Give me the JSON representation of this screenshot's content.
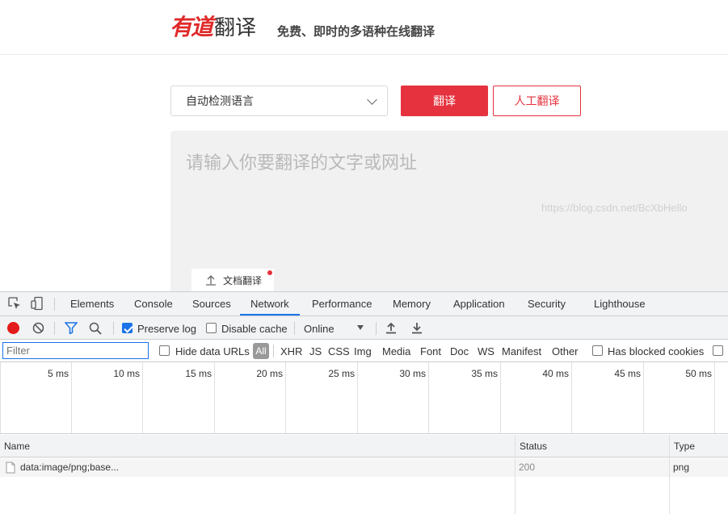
{
  "youdao": {
    "brand": "有道",
    "product": "翻译",
    "slogan": "免费、即时的多语种在线翻译",
    "lang_select": "自动检测语言",
    "translate_button": "翻译",
    "human_translate_button": "人工翻译",
    "input_placeholder": "请输入你要翻译的文字或网址",
    "doc_translate": "文档翻译",
    "accent_color": "#e5323e"
  },
  "devtools": {
    "tabs": [
      "Elements",
      "Console",
      "Sources",
      "Network",
      "Performance",
      "Memory",
      "Application",
      "Security",
      "Lighthouse"
    ],
    "active_tab": "Network",
    "toolbar": {
      "preserve_log": "Preserve log",
      "preserve_log_checked": true,
      "disable_cache": "Disable cache",
      "disable_cache_checked": false,
      "throttle": "Online"
    },
    "filter": {
      "placeholder": "Filter",
      "hide_data_urls": "Hide data URLs",
      "types": [
        "All",
        "XHR",
        "JS",
        "CSS",
        "Img",
        "Media",
        "Font",
        "Doc",
        "WS",
        "Manifest",
        "Other"
      ],
      "selected_type": "All",
      "has_blocked_cookies": "Has blocked cookies"
    },
    "timeline_ticks": [
      "5 ms",
      "10 ms",
      "15 ms",
      "20 ms",
      "25 ms",
      "30 ms",
      "35 ms",
      "40 ms",
      "45 ms",
      "50 ms"
    ],
    "table": {
      "columns": [
        "Name",
        "Status",
        "Type"
      ],
      "rows": [
        {
          "name": "data:image/png;base...",
          "status": "200",
          "type": "png"
        }
      ]
    }
  },
  "watermark": "https://blog.csdn.net/BcXbHello"
}
